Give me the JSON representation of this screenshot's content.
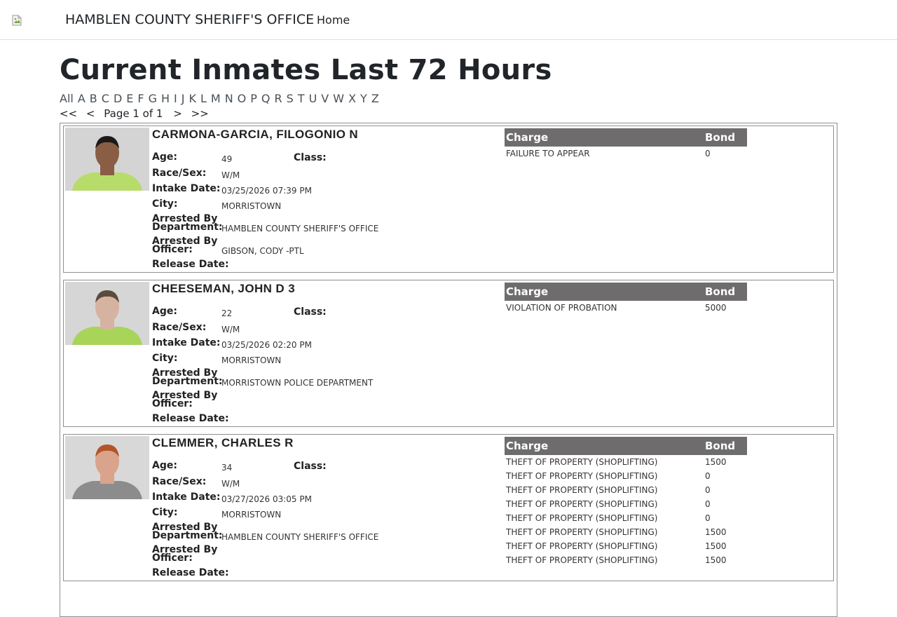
{
  "navbar": {
    "brand": "HAMBLEN COUNTY SHERIFF'S OFFICE",
    "home_link": "Home"
  },
  "page": {
    "title": "Current Inmates Last 72 Hours",
    "letters": [
      "All",
      "A",
      "B",
      "C",
      "D",
      "E",
      "F",
      "G",
      "H",
      "I",
      "J",
      "K",
      "L",
      "M",
      "N",
      "O",
      "P",
      "Q",
      "R",
      "S",
      "T",
      "U",
      "V",
      "W",
      "X",
      "Y",
      "Z"
    ],
    "pager": {
      "first": "<<",
      "prev": "<",
      "page_text": "Page 1 of 1",
      "next": ">",
      "last": ">>"
    }
  },
  "labels": {
    "age": "Age:",
    "race_sex": "Race/Sex:",
    "intake_date": "Intake Date:",
    "city": "City:",
    "arrested_by_department_1": "Arrested By",
    "arrested_by_department_2": "Department:",
    "arrested_by_officer_1": "Arrested By",
    "arrested_by_officer_2": "Officer:",
    "release_date": "Release Date:",
    "class": "Class:",
    "charge_header": "Charge",
    "bond_header": "Bond"
  },
  "inmates": [
    {
      "name": "CARMONA-GARCIA, FILOGONIO N",
      "age": "49",
      "race_sex": "W/M",
      "intake_date": "03/25/2026 07:39 PM",
      "city": "MORRISTOWN",
      "department": "HAMBLEN COUNTY SHERIFF'S OFFICE",
      "officer": "GIBSON, CODY -PTL",
      "release_date": "",
      "class": "",
      "photo": {
        "bg": "#d4d4d4",
        "skin": "#8a5e44",
        "hair": "#1c1a19",
        "shirt": "#b7dc6a"
      },
      "charges": [
        {
          "charge": "FAILURE TO APPEAR",
          "bond": "0"
        }
      ]
    },
    {
      "name": "CHEESEMAN, JOHN D 3",
      "age": "22",
      "race_sex": "W/M",
      "intake_date": "03/25/2026 02:20 PM",
      "city": "MORRISTOWN",
      "department": "MORRISTOWN POLICE DEPARTMENT",
      "officer": "",
      "release_date": "",
      "class": "",
      "photo": {
        "bg": "#d6d6d6",
        "skin": "#d6b3a0",
        "hair": "#5b4a3e",
        "shirt": "#a8d45a"
      },
      "charges": [
        {
          "charge": "VIOLATION OF PROBATION",
          "bond": "5000"
        }
      ]
    },
    {
      "name": "CLEMMER, CHARLES R",
      "age": "34",
      "race_sex": "W/M",
      "intake_date": "03/27/2026 03:05 PM",
      "city": "MORRISTOWN",
      "department": "HAMBLEN COUNTY SHERIFF'S OFFICE",
      "officer": "",
      "release_date": "",
      "class": "",
      "photo": {
        "bg": "#d8d8d8",
        "skin": "#d9a48b",
        "hair": "#b5532b",
        "shirt": "#8c8c8c"
      },
      "charges": [
        {
          "charge": "THEFT OF PROPERTY (SHOPLIFTING)",
          "bond": "1500"
        },
        {
          "charge": "THEFT OF PROPERTY (SHOPLIFTING)",
          "bond": "0"
        },
        {
          "charge": "THEFT OF PROPERTY (SHOPLIFTING)",
          "bond": "0"
        },
        {
          "charge": "THEFT OF PROPERTY (SHOPLIFTING)",
          "bond": "0"
        },
        {
          "charge": "THEFT OF PROPERTY (SHOPLIFTING)",
          "bond": "0"
        },
        {
          "charge": "THEFT OF PROPERTY (SHOPLIFTING)",
          "bond": "1500"
        },
        {
          "charge": "THEFT OF PROPERTY (SHOPLIFTING)",
          "bond": "1500"
        },
        {
          "charge": "THEFT OF PROPERTY (SHOPLIFTING)",
          "bond": "1500"
        }
      ]
    }
  ]
}
